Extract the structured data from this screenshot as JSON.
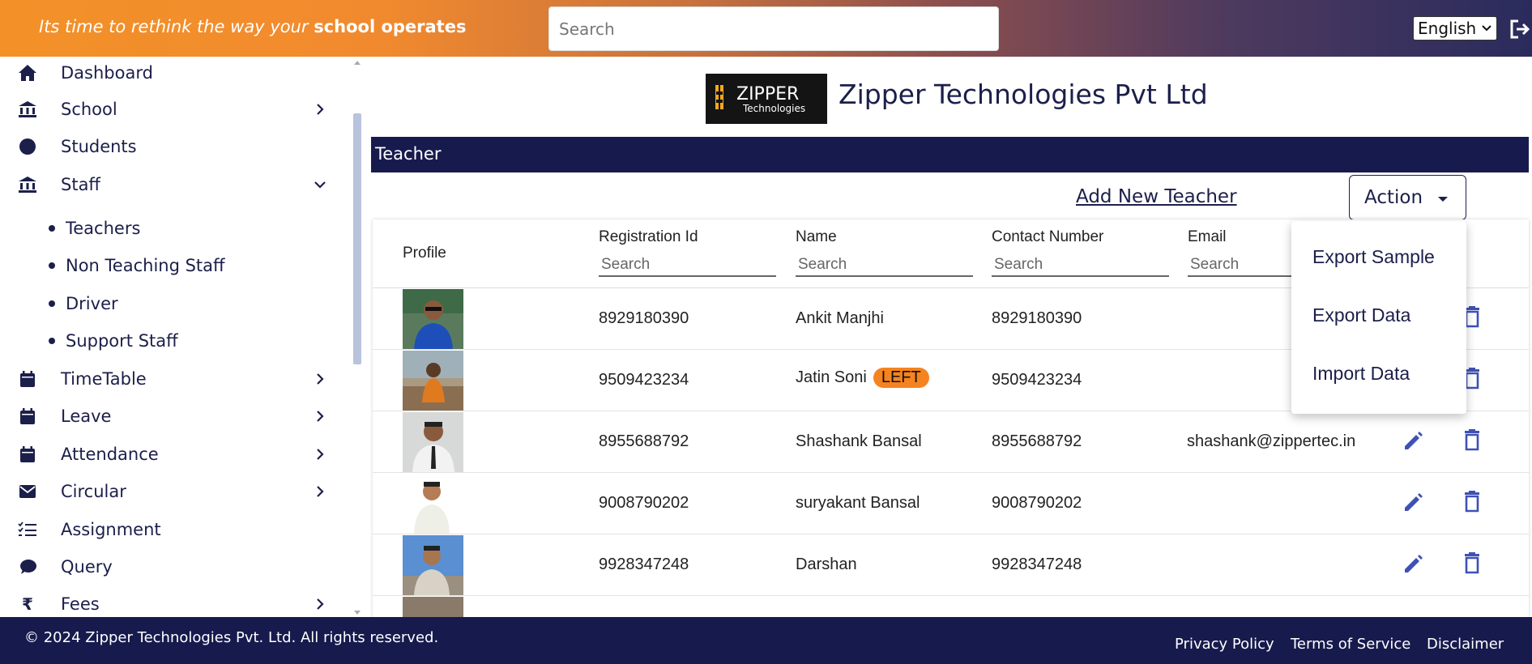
{
  "header": {
    "tagline_italic": "Its time to rethink the way your ",
    "tagline_bold": "school operates",
    "search_placeholder": "Search",
    "language": "English"
  },
  "sidebar": {
    "items": [
      {
        "label": "Dashboard",
        "icon": "home-icon"
      },
      {
        "label": "School",
        "icon": "bank-icon"
      },
      {
        "label": "Students",
        "icon": "circle-icon"
      },
      {
        "label": "Staff",
        "icon": "bank-icon"
      },
      {
        "label": "TimeTable",
        "icon": "calendar-icon"
      },
      {
        "label": "Leave",
        "icon": "calendar-icon"
      },
      {
        "label": "Attendance",
        "icon": "calendar-icon"
      },
      {
        "label": "Circular",
        "icon": "mail-icon"
      },
      {
        "label": "Assignment",
        "icon": "checklist-icon"
      },
      {
        "label": "Query",
        "icon": "chat-icon"
      },
      {
        "label": "Fees",
        "icon": "rupee-icon"
      }
    ],
    "staff_sub": [
      "Teachers",
      "Non Teaching Staff",
      "Driver",
      "Support Staff"
    ]
  },
  "main": {
    "company_title": "Zipper Technologies Pvt Ltd",
    "logo_text": "ZIPPER",
    "logo_sub": "Technologies",
    "section_title": "Teacher",
    "add_link": "Add New Teacher",
    "action_label": "Action",
    "columns": {
      "profile": "Profile",
      "registration": "Registration Id",
      "name": "Name",
      "contact": "Contact Number",
      "email": "Email",
      "search_placeholder": "Search"
    },
    "rows": [
      {
        "reg": "8929180390",
        "name": "Ankit Manjhi",
        "badge": "",
        "contact": "8929180390",
        "email": ""
      },
      {
        "reg": "9509423234",
        "name": "Jatin Soni",
        "badge": "LEFT",
        "contact": "9509423234",
        "email": ""
      },
      {
        "reg": "8955688792",
        "name": "Shashank Bansal",
        "badge": "",
        "contact": "8955688792",
        "email": "shashank@zippertec.in"
      },
      {
        "reg": "9008790202",
        "name": "suryakant Bansal",
        "badge": "",
        "contact": "9008790202",
        "email": ""
      },
      {
        "reg": "9928347248",
        "name": "Darshan",
        "badge": "",
        "contact": "9928347248",
        "email": ""
      }
    ],
    "action_menu": [
      "Export Sample",
      "Export Data",
      "Import Data"
    ]
  },
  "footer": {
    "copyright": "© 2024 Zipper Technologies Pvt. Ltd. All rights reserved.",
    "links": [
      "Privacy Policy",
      "Terms of Service",
      "Disclaimer"
    ]
  },
  "colors": {
    "primary": "#171a4d",
    "accent": "#f5831f",
    "icon_blue": "#3f51b5"
  }
}
